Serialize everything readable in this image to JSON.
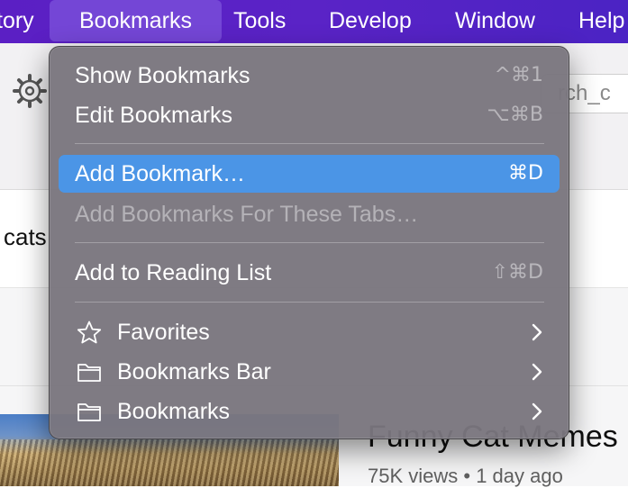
{
  "menubar": {
    "items": [
      {
        "label": "tory"
      },
      {
        "label": "Bookmarks"
      },
      {
        "label": "Tools"
      },
      {
        "label": "Develop"
      },
      {
        "label": "Window"
      },
      {
        "label": "Help"
      }
    ]
  },
  "browser": {
    "search_snippet": "rch_c",
    "query_snippet": "cats",
    "result": {
      "title": "Funny Cat Memes",
      "meta": "75K views • 1 day ago"
    }
  },
  "menu": {
    "items": [
      {
        "label": "Show Bookmarks",
        "shortcut": "^⌘1",
        "state": "normal"
      },
      {
        "label": "Edit Bookmarks",
        "shortcut": "⌥⌘B",
        "state": "normal"
      },
      {
        "label": "Add Bookmark…",
        "shortcut": "⌘D",
        "state": "highlighted"
      },
      {
        "label": "Add Bookmarks For These Tabs…",
        "shortcut": "",
        "state": "disabled"
      },
      {
        "label": "Add to Reading List",
        "shortcut": "⇧⌘D",
        "state": "normal"
      },
      {
        "label": "Favorites",
        "icon": "star-icon",
        "submenu": true
      },
      {
        "label": "Bookmarks Bar",
        "icon": "folder-icon",
        "submenu": true
      },
      {
        "label": "Bookmarks",
        "icon": "folder-icon",
        "submenu": true
      }
    ]
  },
  "colors": {
    "menubar_bg": "#5b1fc4",
    "menu_bg": "#7a767e",
    "highlight": "#4b95e6"
  }
}
